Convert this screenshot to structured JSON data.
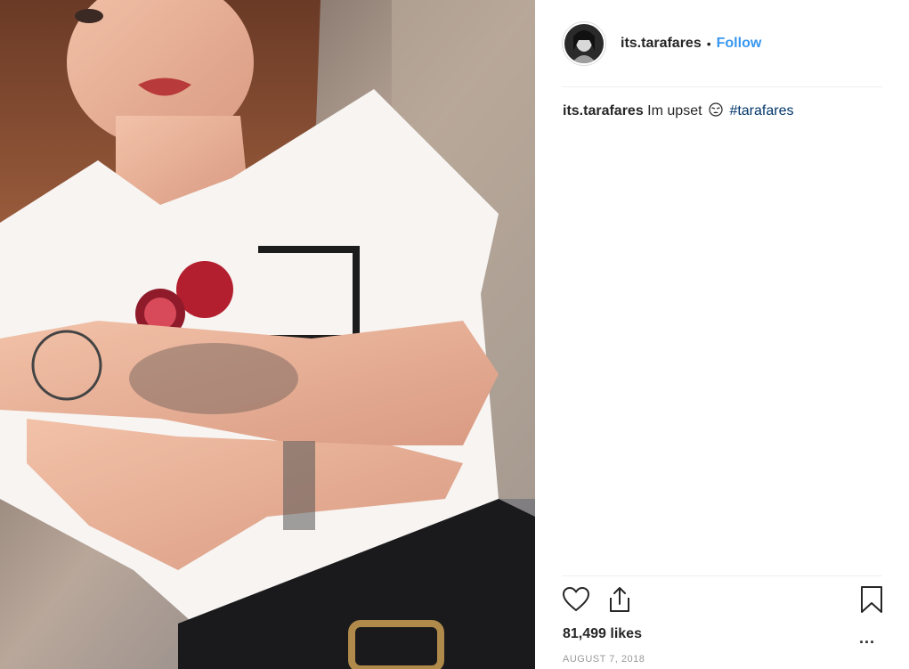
{
  "post": {
    "username": "its.tarafares",
    "separator": "•",
    "follow_label": "Follow",
    "caption": {
      "username": "its.tarafares",
      "text": "Im upset",
      "emoji": "tired-face-emoji",
      "hashtag": "#tarafares"
    },
    "likes": "81,499 likes",
    "more_label": "...",
    "date": "AUGUST 7, 2018"
  },
  "icons": {
    "like": "heart-icon",
    "share": "share-icon",
    "save": "bookmark-icon"
  },
  "colors": {
    "follow": "#3897f0",
    "hashtag": "#003569",
    "divider": "#efefef",
    "date": "#999999"
  }
}
